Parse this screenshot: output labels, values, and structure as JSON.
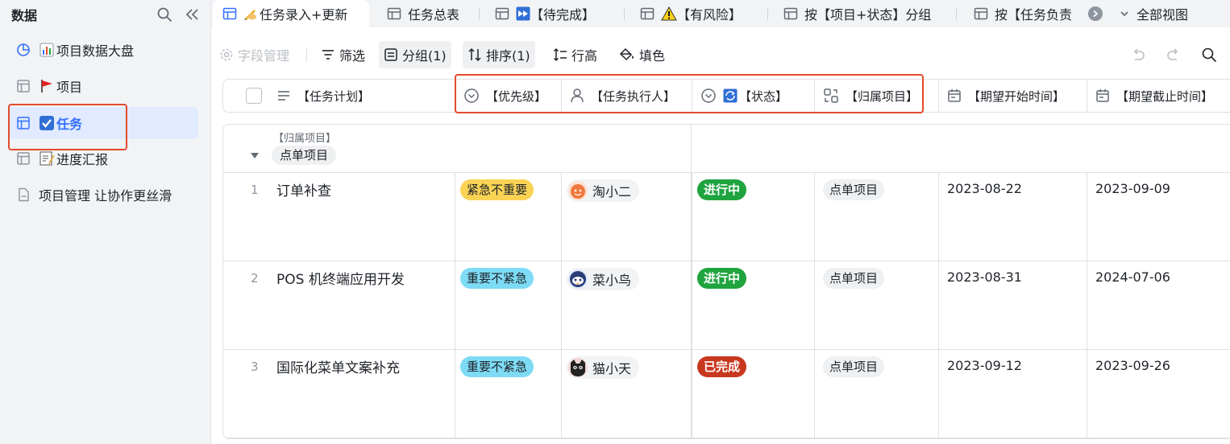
{
  "sidebar": {
    "title": "数据",
    "items": [
      {
        "label": "项目数据大盘",
        "icon": "dashboard-icon",
        "emoji": "bar-chart-emoji"
      },
      {
        "label": "项目",
        "icon": "table-icon",
        "emoji": "red-flag-emoji"
      },
      {
        "label": "任务",
        "icon": "table-icon",
        "emoji": "checkbox-emoji"
      },
      {
        "label": "进度汇报",
        "icon": "table-icon",
        "emoji": "memo-emoji"
      },
      {
        "label": "项目管理 让协作更丝滑",
        "icon": "document-icon"
      }
    ]
  },
  "tabs": [
    {
      "label": "任务录入+更新"
    },
    {
      "label": "任务总表"
    },
    {
      "label": "【待完成】"
    },
    {
      "label": "【有风险】"
    },
    {
      "label": "按【项目+状态】分组"
    },
    {
      "label": "按【任务负责"
    }
  ],
  "all_views": "全部视图",
  "toolbar": {
    "fields": "字段管理",
    "filter": "筛选",
    "group": "分组(1)",
    "sort": "排序(1)",
    "row_height": "行高",
    "fill": "填色"
  },
  "columns": [
    "【任务计划】",
    "【优先级】",
    "【任务执行人】",
    "【状态】",
    "【归属项目】",
    "【期望开始时间】",
    "【期望截止时间】"
  ],
  "group": {
    "field": "【归属项目】",
    "value": "点单项目"
  },
  "rows": [
    {
      "num": "1",
      "title": "订单补查",
      "priority": "紧急不重要",
      "priority_color": "#fad355",
      "assignee": "淘小二",
      "status": "进行中",
      "status_color": "#1fa43f",
      "project": "点单项目",
      "start": "2023-08-22",
      "end": "2023-09-09"
    },
    {
      "num": "2",
      "title": "POS 机终端应用开发",
      "priority": "重要不紧急",
      "priority_color": "#7edbf5",
      "assignee": "菜小鸟",
      "status": "进行中",
      "status_color": "#1fa43f",
      "project": "点单项目",
      "start": "2023-08-31",
      "end": "2024-07-06"
    },
    {
      "num": "3",
      "title": "国际化菜单文案补充",
      "priority": "重要不紧急",
      "priority_color": "#7edbf5",
      "assignee": "猫小天",
      "status": "已完成",
      "status_color": "#c8381f",
      "project": "点单项目",
      "start": "2023-09-12",
      "end": "2023-09-26"
    }
  ],
  "colors": {
    "accent": "#3370ff",
    "highlight_box": "#e34b2e"
  }
}
